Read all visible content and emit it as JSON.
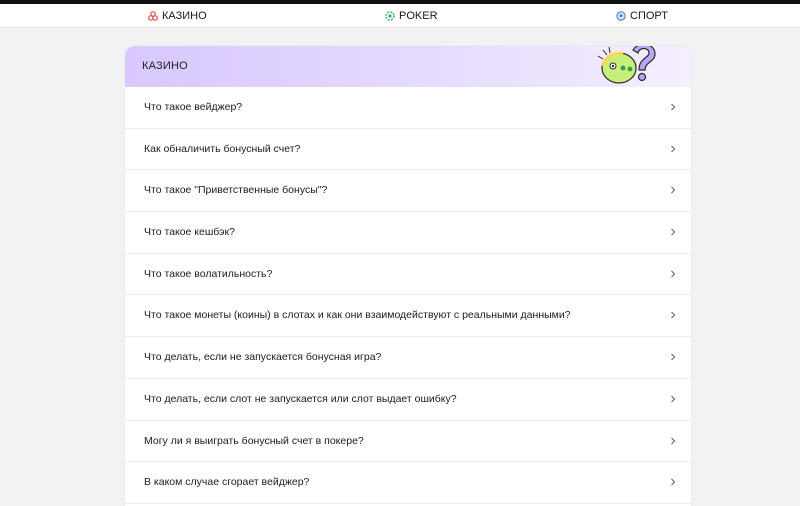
{
  "nav": {
    "casino": "КАЗИНО",
    "poker": "POKER",
    "sport": "СПОРТ"
  },
  "section": {
    "title": "КАЗИНО"
  },
  "faq": [
    "Что такое вейджер?",
    "Как обналичить бонусный счет?",
    "Что такое \"Приветственные бонусы\"?",
    "Что такое кешбэк?",
    "Что такое волатильность?",
    "Что такое монеты (коины) в слотах и как они взаимодействуют с реальными данными?",
    "Что делать, если не запускается бонусная игра?",
    "Что делать, если слот не запускается или слот выдает ошибку?",
    "Могу ли я выиграть бонусный счет в покере?",
    "В каком случае сгорает вейджер?"
  ],
  "colors": {
    "casino_icon": "#e0504a",
    "poker_icon": "#3fae5a",
    "sport_icon": "#3d7fd6",
    "header_gradient_start": "#d8c8ff"
  }
}
